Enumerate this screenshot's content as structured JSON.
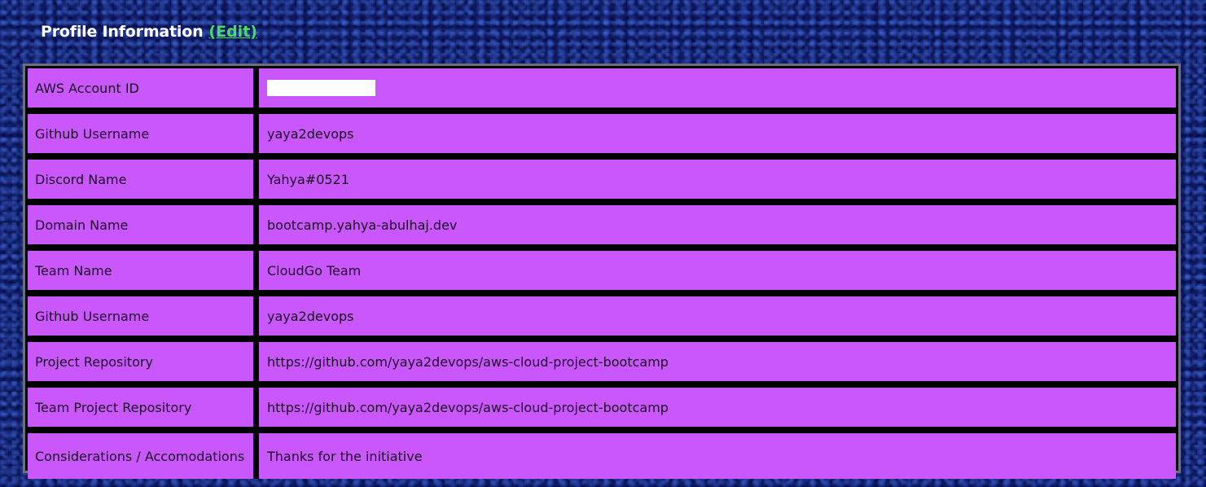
{
  "header": {
    "title": "Profile Information",
    "edit_label": "(Edit)"
  },
  "profile": {
    "rows": [
      {
        "label": "AWS Account ID",
        "value": ""
      },
      {
        "label": "Github Username",
        "value": "yaya2devops"
      },
      {
        "label": "Discord Name",
        "value": "Yahya#0521"
      },
      {
        "label": "Domain Name",
        "value": "bootcamp.yahya-abulhaj.dev"
      },
      {
        "label": "Team Name",
        "value": "CloudGo Team"
      },
      {
        "label": "Github Username",
        "value": "yaya2devops"
      },
      {
        "label": "Project Repository",
        "value": "https://github.com/yaya2devops/aws-cloud-project-bootcamp"
      },
      {
        "label": "Team Project Repository",
        "value": "https://github.com/yaya2devops/aws-cloud-project-bootcamp"
      },
      {
        "label": "Considerations / Accomodations",
        "value": "Thanks for the initiative"
      }
    ]
  },
  "colors": {
    "background": "#0d1a63",
    "cell": "#c957fb",
    "link": "#4cd964",
    "frame": "#6e6e7e"
  }
}
